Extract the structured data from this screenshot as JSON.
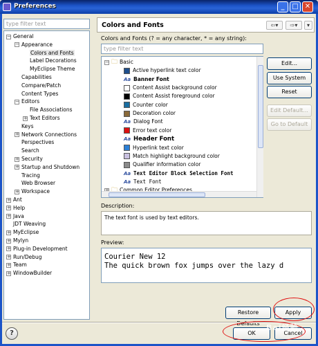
{
  "window": {
    "title": "Preferences"
  },
  "left": {
    "filter_placeholder": "type filter text",
    "tree": [
      {
        "label": "General",
        "indent": 0,
        "exp": "−"
      },
      {
        "label": "Appearance",
        "indent": 1,
        "exp": "−"
      },
      {
        "label": "Colors and Fonts",
        "indent": 2,
        "exp": "",
        "sel": true
      },
      {
        "label": "Label Decorations",
        "indent": 2,
        "exp": ""
      },
      {
        "label": "MyEclipse Theme",
        "indent": 2,
        "exp": ""
      },
      {
        "label": "Capabilities",
        "indent": 1,
        "exp": ""
      },
      {
        "label": "Compare/Patch",
        "indent": 1,
        "exp": ""
      },
      {
        "label": "Content Types",
        "indent": 1,
        "exp": ""
      },
      {
        "label": "Editors",
        "indent": 1,
        "exp": "−"
      },
      {
        "label": "File Associations",
        "indent": 2,
        "exp": ""
      },
      {
        "label": "Text Editors",
        "indent": 2,
        "exp": "+"
      },
      {
        "label": "Keys",
        "indent": 1,
        "exp": ""
      },
      {
        "label": "Network Connections",
        "indent": 1,
        "exp": "+"
      },
      {
        "label": "Perspectives",
        "indent": 1,
        "exp": ""
      },
      {
        "label": "Search",
        "indent": 1,
        "exp": ""
      },
      {
        "label": "Security",
        "indent": 1,
        "exp": "+"
      },
      {
        "label": "Startup and Shutdown",
        "indent": 1,
        "exp": "+"
      },
      {
        "label": "Tracing",
        "indent": 1,
        "exp": ""
      },
      {
        "label": "Web Browser",
        "indent": 1,
        "exp": ""
      },
      {
        "label": "Workspace",
        "indent": 1,
        "exp": "+"
      },
      {
        "label": "Ant",
        "indent": 0,
        "exp": "+"
      },
      {
        "label": "Help",
        "indent": 0,
        "exp": "+"
      },
      {
        "label": "Java",
        "indent": 0,
        "exp": "+"
      },
      {
        "label": "JDT Weaving",
        "indent": 0,
        "exp": ""
      },
      {
        "label": "MyEclipse",
        "indent": 0,
        "exp": "+"
      },
      {
        "label": "Mylyn",
        "indent": 0,
        "exp": "+"
      },
      {
        "label": "Plug-in Development",
        "indent": 0,
        "exp": "+"
      },
      {
        "label": "Run/Debug",
        "indent": 0,
        "exp": "+"
      },
      {
        "label": "Team",
        "indent": 0,
        "exp": "+"
      },
      {
        "label": "WindowBuilder",
        "indent": 0,
        "exp": "+"
      }
    ]
  },
  "right": {
    "title": "Colors and Fonts",
    "nav": {
      "back": "⇦▾",
      "fwd": "⇨▾",
      "menu": "▾"
    },
    "list_label": "Colors and Fonts (? = any character, * = any string):",
    "filter_placeholder": "type filter text",
    "list": [
      {
        "kind": "folder",
        "label": "Basic",
        "indent": 0,
        "exp": "−"
      },
      {
        "kind": "color",
        "label": "Active hyperlink text color",
        "color": "#1e4e8c"
      },
      {
        "kind": "font",
        "label": "Banner Font",
        "style": "bold"
      },
      {
        "kind": "color",
        "label": "Content Assist background color",
        "color": "#ffffff"
      },
      {
        "kind": "color",
        "label": "Content Assist foreground color",
        "color": "#000000"
      },
      {
        "kind": "color",
        "label": "Counter color",
        "color": "#1a6ea0"
      },
      {
        "kind": "color",
        "label": "Decoration color",
        "color": "#8a6a3a"
      },
      {
        "kind": "font",
        "label": "Dialog Font",
        "style": "normal"
      },
      {
        "kind": "color",
        "label": "Error text color",
        "color": "#dd1111"
      },
      {
        "kind": "font",
        "label": "Header Font",
        "style": "header"
      },
      {
        "kind": "color",
        "label": "Hyperlink text color",
        "color": "#2b7fd6"
      },
      {
        "kind": "color",
        "label": "Match highlight background color",
        "color": "#c8c0e0"
      },
      {
        "kind": "color",
        "label": "Qualifier information color",
        "color": "#8a8a8a"
      },
      {
        "kind": "font",
        "label": "Text Editor Block Selection Font",
        "style": "mono-bold"
      },
      {
        "kind": "font",
        "label": "Text Font",
        "style": "mono"
      },
      {
        "kind": "folder",
        "label": "Common Editor Preferences",
        "indent": 0,
        "exp": "+"
      }
    ],
    "buttons": {
      "edit": "Edit...",
      "use_system": "Use System Font",
      "reset": "Reset",
      "edit_default": "Edit Default...",
      "goto_default": "Go to Default"
    },
    "description_label": "Description:",
    "description": "The text font is used by text editors.",
    "preview_label": "Preview:",
    "preview_lines": [
      "Courier New 12",
      "The quick brown fox jumps over the lazy d"
    ]
  },
  "bottom": {
    "restore": "Restore Defaults",
    "apply": "Apply",
    "ok": "OK",
    "cancel": "Cancel"
  },
  "watermark": "Bai经验"
}
